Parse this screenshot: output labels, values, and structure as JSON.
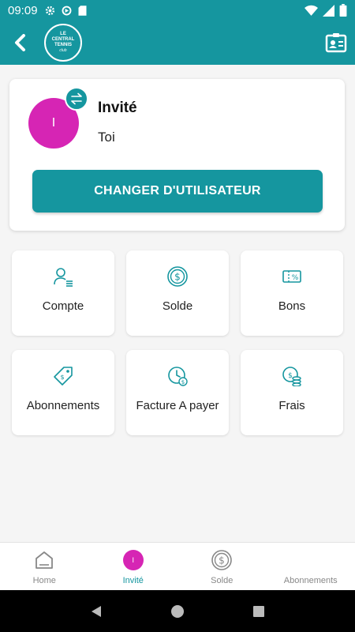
{
  "status_bar": {
    "time": "09:09"
  },
  "app_bar": {
    "logo_line1": "LE",
    "logo_line2": "CENTRAL",
    "logo_line3": "TENNIS",
    "logo_line4": "club"
  },
  "user_card": {
    "avatar_initial": "I",
    "name": "Invité",
    "subtitle": "Toi",
    "switch_button": "CHANGER D'UTILISATEUR"
  },
  "tiles": [
    {
      "label": "Compte",
      "icon": "user-list-icon"
    },
    {
      "label": "Solde",
      "icon": "dollar-coin-icon"
    },
    {
      "label": "Bons",
      "icon": "voucher-icon"
    },
    {
      "label": "Abonnements",
      "icon": "price-tag-icon"
    },
    {
      "label": "Facture A payer",
      "icon": "invoice-clock-icon"
    },
    {
      "label": "Frais",
      "icon": "coins-icon"
    }
  ],
  "bottom_nav": [
    {
      "label": "Home",
      "icon": "home-icon"
    },
    {
      "label": "Invité",
      "icon": "avatar-icon",
      "avatar_initial": "I"
    },
    {
      "label": "Solde",
      "icon": "dollar-coin-icon"
    },
    {
      "label": "Abonnements",
      "icon": "none"
    }
  ],
  "colors": {
    "primary": "#15969f",
    "avatar": "#d625b4",
    "background": "#f5f5f5"
  }
}
